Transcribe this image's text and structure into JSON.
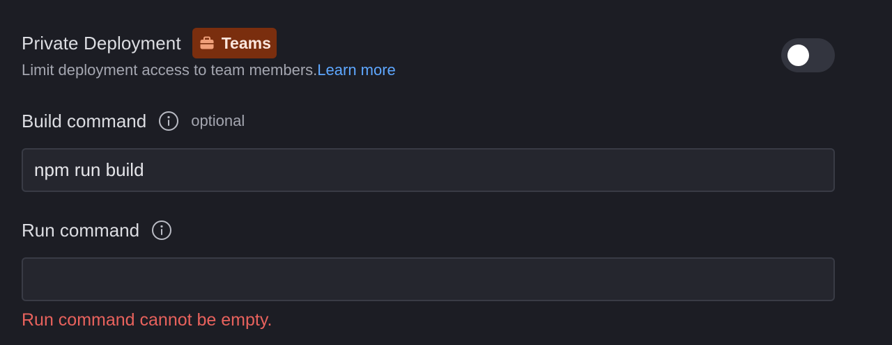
{
  "private_deployment": {
    "title": "Private Deployment",
    "badge_label": "Teams",
    "badge_icon": "briefcase-icon",
    "description": "Limit deployment access to team members.",
    "learn_more": "Learn more",
    "toggle_on": false
  },
  "build_command": {
    "label": "Build command",
    "info_icon": "info-icon",
    "optional_text": "optional",
    "value": "npm run build"
  },
  "run_command": {
    "label": "Run command",
    "info_icon": "info-icon",
    "value": "",
    "error": "Run command cannot be empty."
  },
  "colors": {
    "background": "#1c1d24",
    "badge_bg": "#7a2e0e",
    "badge_icon": "#f0a07a",
    "link": "#5ea7ff",
    "error": "#e8625d",
    "input_bg": "#25262e",
    "input_border": "#393b45"
  }
}
